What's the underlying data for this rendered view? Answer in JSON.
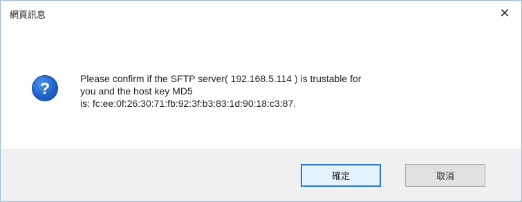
{
  "dialog": {
    "title": "網頁訊息",
    "close_glyph": "✕",
    "icon_glyph": "?",
    "message_lines": [
      "Please confirm if the SFTP server( 192.168.5.114 ) is trustable for",
      "you and the host key MD5",
      "is: fc:ee:0f:26:30:71:fb:92:3f:b3:83:1d:90:18:c3:87."
    ],
    "buttons": {
      "ok_label": "確定",
      "cancel_label": "取消"
    }
  }
}
